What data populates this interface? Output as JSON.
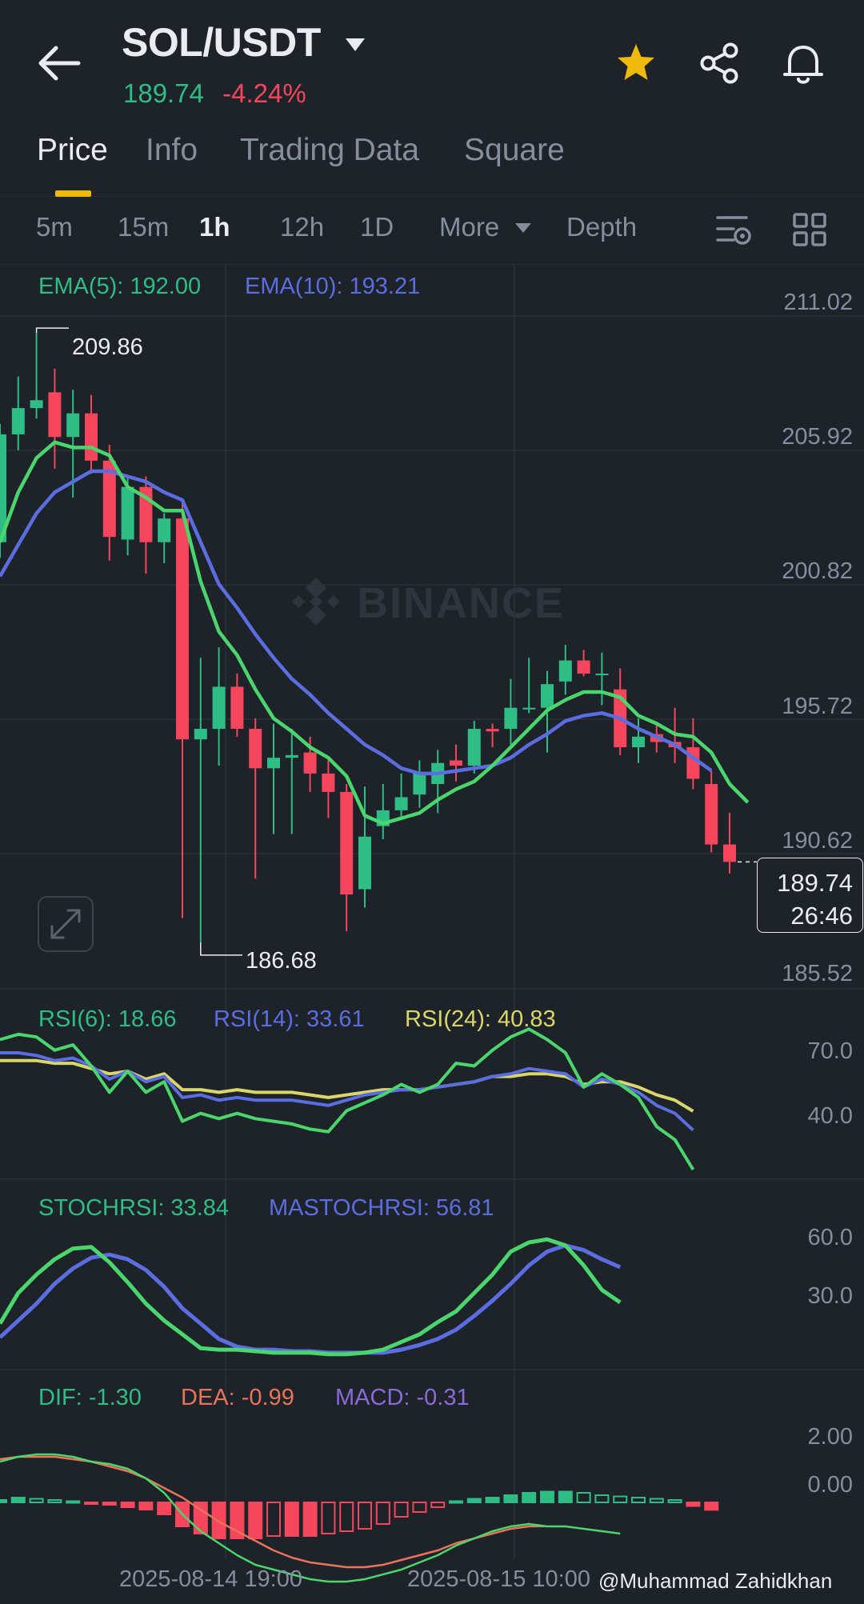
{
  "header": {
    "pair": "SOL/USDT",
    "last_price": "189.74",
    "change": "-4.24%",
    "colors": {
      "up": "#2ebd85",
      "down": "#f6465d",
      "accent": "#f0b90b"
    },
    "icons": [
      "back-arrow-icon",
      "dropdown-caret-icon",
      "favorite-star-icon",
      "share-icon",
      "bell-icon"
    ]
  },
  "tabs": [
    {
      "label": "Price",
      "active": true
    },
    {
      "label": "Info",
      "active": false
    },
    {
      "label": "Trading Data",
      "active": false
    },
    {
      "label": "Square",
      "active": false
    }
  ],
  "timeframes": {
    "items": [
      "5m",
      "15m",
      "1h",
      "12h",
      "1D"
    ],
    "active": "1h",
    "more": "More",
    "depth": "Depth"
  },
  "main_chart": {
    "ema5": "EMA(5): 192.00",
    "ema10": "EMA(10): 193.21",
    "y_axis": [
      "211.02",
      "205.92",
      "200.82",
      "195.72",
      "190.62",
      "185.52"
    ],
    "high_label": "209.86",
    "low_label": "186.68",
    "current_price": "189.74",
    "countdown": "26:46",
    "watermark": "BINANCE"
  },
  "rsi": {
    "rsi6": "RSI(6): 18.66",
    "rsi14": "RSI(14): 33.61",
    "rsi24": "RSI(24): 40.83",
    "y_axis": [
      "70.0",
      "40.0"
    ]
  },
  "stochrsi": {
    "stoch": "STOCHRSI: 33.84",
    "ma": "MASTOCHRSI: 56.81",
    "y_axis": [
      "60.0",
      "30.0"
    ]
  },
  "macd": {
    "dif": "DIF: -1.30",
    "dea": "DEA: -0.99",
    "macd": "MACD: -0.31",
    "y_axis": [
      "2.00",
      "0.00"
    ]
  },
  "x_axis": [
    "2025-08-14 19:00",
    "2025-08-15 10:00"
  ],
  "attribution": "@Muhammad Zahidkhan",
  "chart_data": {
    "type": "candlestick",
    "interval": "1h",
    "ylim": [
      185.52,
      211.02
    ],
    "candles": [
      {
        "o": 201.9,
        "h": 206.4,
        "l": 201.3,
        "c": 206.0
      },
      {
        "o": 206.0,
        "h": 208.2,
        "l": 205.4,
        "c": 207.0
      },
      {
        "o": 207.0,
        "h": 209.86,
        "l": 206.6,
        "c": 207.3
      },
      {
        "o": 207.6,
        "h": 208.5,
        "l": 204.7,
        "c": 205.9
      },
      {
        "o": 205.9,
        "h": 207.7,
        "l": 203.6,
        "c": 206.8
      },
      {
        "o": 206.8,
        "h": 207.5,
        "l": 204.5,
        "c": 205.0
      },
      {
        "o": 205.0,
        "h": 205.6,
        "l": 201.2,
        "c": 202.1
      },
      {
        "o": 202.0,
        "h": 204.4,
        "l": 201.4,
        "c": 204.0
      },
      {
        "o": 204.0,
        "h": 204.4,
        "l": 200.7,
        "c": 201.9
      },
      {
        "o": 201.9,
        "h": 203.0,
        "l": 201.1,
        "c": 202.8
      },
      {
        "o": 202.8,
        "h": 203.5,
        "l": 187.6,
        "c": 194.4
      },
      {
        "o": 194.4,
        "h": 197.5,
        "l": 186.68,
        "c": 194.8
      },
      {
        "o": 194.8,
        "h": 197.9,
        "l": 193.4,
        "c": 196.4
      },
      {
        "o": 196.4,
        "h": 196.9,
        "l": 194.5,
        "c": 194.8
      },
      {
        "o": 194.8,
        "h": 195.2,
        "l": 189.1,
        "c": 193.3
      },
      {
        "o": 193.3,
        "h": 195.0,
        "l": 190.8,
        "c": 193.7
      },
      {
        "o": 193.7,
        "h": 194.8,
        "l": 190.8,
        "c": 193.8
      },
      {
        "o": 193.9,
        "h": 194.5,
        "l": 192.4,
        "c": 193.1
      },
      {
        "o": 193.1,
        "h": 193.6,
        "l": 191.4,
        "c": 192.4
      },
      {
        "o": 192.4,
        "h": 192.7,
        "l": 187.1,
        "c": 188.5
      },
      {
        "o": 188.7,
        "h": 192.6,
        "l": 188.0,
        "c": 190.7
      },
      {
        "o": 191.1,
        "h": 192.7,
        "l": 190.6,
        "c": 191.7
      },
      {
        "o": 191.7,
        "h": 193.1,
        "l": 191.4,
        "c": 192.2
      },
      {
        "o": 192.3,
        "h": 193.6,
        "l": 191.8,
        "c": 193.1
      },
      {
        "o": 192.7,
        "h": 194.0,
        "l": 191.6,
        "c": 193.5
      },
      {
        "o": 193.6,
        "h": 194.2,
        "l": 192.8,
        "c": 193.4
      },
      {
        "o": 193.4,
        "h": 195.1,
        "l": 193.1,
        "c": 194.8
      },
      {
        "o": 194.8,
        "h": 195.0,
        "l": 194.1,
        "c": 194.7
      },
      {
        "o": 194.8,
        "h": 196.7,
        "l": 194.2,
        "c": 195.6
      },
      {
        "o": 195.6,
        "h": 197.5,
        "l": 195.4,
        "c": 195.6
      },
      {
        "o": 195.6,
        "h": 197.0,
        "l": 193.9,
        "c": 196.5
      },
      {
        "o": 196.6,
        "h": 198.0,
        "l": 196.1,
        "c": 197.4
      },
      {
        "o": 197.4,
        "h": 197.8,
        "l": 196.8,
        "c": 196.9
      },
      {
        "o": 196.9,
        "h": 197.7,
        "l": 195.7,
        "c": 196.9
      },
      {
        "o": 196.3,
        "h": 197.1,
        "l": 193.8,
        "c": 194.1
      },
      {
        "o": 194.1,
        "h": 195.2,
        "l": 193.5,
        "c": 194.5
      },
      {
        "o": 194.6,
        "h": 195.0,
        "l": 193.9,
        "c": 194.3
      },
      {
        "o": 194.3,
        "h": 195.6,
        "l": 193.5,
        "c": 194.1
      },
      {
        "o": 194.1,
        "h": 195.2,
        "l": 192.5,
        "c": 192.9
      },
      {
        "o": 192.7,
        "h": 193.2,
        "l": 190.1,
        "c": 190.4
      },
      {
        "o": 190.4,
        "h": 191.6,
        "l": 189.3,
        "c": 189.74
      }
    ],
    "ema5": [
      201.9,
      203.8,
      205.1,
      205.7,
      205.5,
      205.5,
      205.2,
      204.0,
      203.6,
      203.1,
      203.1,
      200.4,
      198.5,
      197.6,
      196.3,
      195.2,
      194.7,
      194.1,
      193.7,
      193.0,
      191.5,
      191.2,
      191.4,
      191.6,
      192.1,
      192.5,
      192.8,
      193.4,
      194.1,
      194.8,
      195.5,
      195.9,
      196.2,
      196.2,
      196.0,
      195.3,
      195.0,
      194.6,
      194.5,
      193.9,
      192.7,
      192.0
    ],
    "ema10": [
      200.6,
      201.8,
      203.0,
      203.8,
      204.2,
      204.6,
      204.6,
      204.4,
      204.2,
      203.8,
      203.5,
      201.9,
      200.3,
      199.4,
      198.4,
      197.5,
      196.7,
      196.1,
      195.4,
      194.8,
      194.2,
      193.8,
      193.3,
      193.1,
      193.1,
      193.2,
      193.3,
      193.4,
      193.7,
      194.2,
      194.6,
      195.1,
      195.3,
      195.4,
      195.2,
      194.8,
      194.5,
      194.2,
      193.7,
      193.21
    ],
    "rsi6": [
      68,
      70,
      69,
      64,
      66,
      58,
      48,
      56,
      48,
      52,
      37,
      40,
      38,
      40,
      38,
      37,
      36,
      34,
      33,
      41,
      44,
      47,
      51,
      48,
      51,
      59,
      58,
      64,
      69,
      72,
      68,
      63,
      50,
      55,
      51,
      46,
      35,
      30,
      18.66
    ],
    "rsi14": [
      63,
      63,
      62,
      60,
      61,
      58,
      53,
      56,
      52,
      54,
      46,
      47,
      45,
      46,
      45,
      45,
      45,
      44,
      43,
      45,
      47,
      48,
      49,
      49,
      50,
      51,
      52,
      54,
      55,
      57,
      56,
      55,
      50,
      53,
      51,
      48,
      43,
      40,
      33.61
    ],
    "rsi24": [
      60,
      60,
      60,
      59,
      59,
      57,
      55,
      56,
      53,
      55,
      49,
      49,
      48,
      49,
      48,
      48,
      48,
      47,
      46,
      47,
      48,
      49,
      49,
      49,
      50,
      51,
      52,
      54,
      54,
      55,
      55,
      54,
      51,
      52,
      52,
      50,
      47,
      45,
      40.83
    ],
    "stochrsi": [
      20,
      40,
      52,
      62,
      69,
      70,
      60,
      47,
      33,
      22,
      13,
      4,
      3,
      3,
      2,
      1,
      1,
      1,
      0,
      0,
      1,
      3,
      8,
      13,
      21,
      28,
      40,
      52,
      67,
      73,
      75,
      71,
      58,
      42,
      33.84
    ],
    "mastochrsi": [
      11,
      22,
      33,
      46,
      56,
      63,
      65,
      62,
      55,
      44,
      30,
      20,
      10,
      5,
      3,
      3,
      2,
      2,
      1,
      1,
      1,
      1,
      3,
      6,
      10,
      16,
      25,
      35,
      46,
      58,
      67,
      71,
      68,
      62,
      56.81
    ],
    "dif": [
      1.7,
      1.9,
      2.0,
      2.0,
      1.9,
      1.7,
      1.6,
      1.4,
      1.0,
      0.4,
      -0.5,
      -1.2,
      -1.7,
      -2.2,
      -2.6,
      -2.8,
      -3.0,
      -3.2,
      -3.3,
      -3.3,
      -3.2,
      -3.0,
      -2.8,
      -2.5,
      -2.2,
      -1.8,
      -1.5,
      -1.2,
      -1.0,
      -0.9,
      -1.0,
      -1.0,
      -1.1,
      -1.2,
      -1.3
    ],
    "dea": [
      1.8,
      1.9,
      1.9,
      1.9,
      1.8,
      1.7,
      1.5,
      1.3,
      1.0,
      0.6,
      0.2,
      -0.3,
      -0.8,
      -1.2,
      -1.6,
      -2.0,
      -2.3,
      -2.5,
      -2.6,
      -2.7,
      -2.7,
      -2.6,
      -2.4,
      -2.2,
      -2.0,
      -1.7,
      -1.5,
      -1.3,
      -1.1,
      -1.0,
      -0.99
    ],
    "macd_hist": [
      0.1,
      0.2,
      0.15,
      0.1,
      0.05,
      -0.05,
      -0.1,
      -0.2,
      -0.3,
      -0.5,
      -1.0,
      -1.3,
      -1.5,
      -1.5,
      -1.5,
      -1.4,
      -1.4,
      -1.4,
      -1.3,
      -1.2,
      -1.1,
      -0.9,
      -0.6,
      -0.4,
      -0.2,
      0.05,
      0.15,
      0.2,
      0.3,
      0.4,
      0.45,
      0.45,
      0.4,
      0.3,
      0.25,
      0.2,
      0.15,
      0.1,
      -0.15,
      -0.31
    ]
  }
}
